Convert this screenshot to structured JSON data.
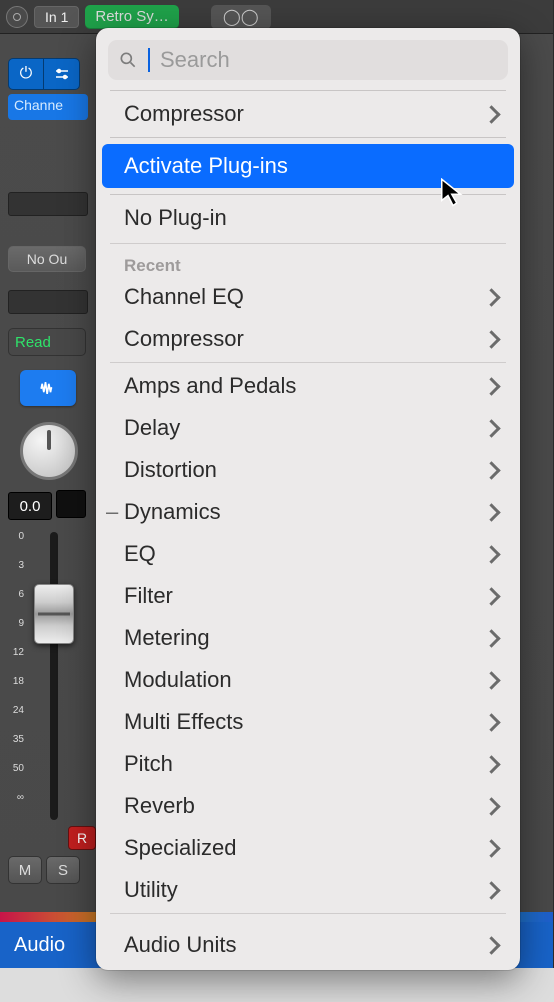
{
  "top": {
    "input_label": "In 1",
    "insert_name": "Retro Sy…",
    "stereo_symbol": "◯◯"
  },
  "strip": {
    "channel_slot": "Channe",
    "no_out": "No Ou",
    "read": "Read",
    "pan_value": "0.0",
    "rec": "R",
    "mute": "M",
    "solo": "S",
    "fader_ticks": [
      "0",
      "3",
      "6",
      "9",
      "12",
      "18",
      "24",
      "35",
      "50",
      "∞"
    ]
  },
  "bottom": {
    "track_name": "Audio"
  },
  "menu": {
    "search_placeholder": "Search",
    "current": {
      "label": "Compressor",
      "has_sub": true
    },
    "activate": "Activate Plug-ins",
    "noplugin": "No Plug-in",
    "recent_label": "Recent",
    "recent": [
      {
        "label": "Channel EQ",
        "has_sub": true
      },
      {
        "label": "Compressor",
        "has_sub": true
      }
    ],
    "categories": [
      {
        "label": "Amps and Pedals",
        "has_sub": true
      },
      {
        "label": "Delay",
        "has_sub": true
      },
      {
        "label": "Distortion",
        "has_sub": true
      },
      {
        "label": "Dynamics",
        "has_sub": true,
        "expanded_marker": true
      },
      {
        "label": "EQ",
        "has_sub": true
      },
      {
        "label": "Filter",
        "has_sub": true
      },
      {
        "label": "Metering",
        "has_sub": true
      },
      {
        "label": "Modulation",
        "has_sub": true
      },
      {
        "label": "Multi Effects",
        "has_sub": true
      },
      {
        "label": "Pitch",
        "has_sub": true
      },
      {
        "label": "Reverb",
        "has_sub": true
      },
      {
        "label": "Specialized",
        "has_sub": true
      },
      {
        "label": "Utility",
        "has_sub": true
      }
    ],
    "audio_units": {
      "label": "Audio Units",
      "has_sub": true
    }
  }
}
